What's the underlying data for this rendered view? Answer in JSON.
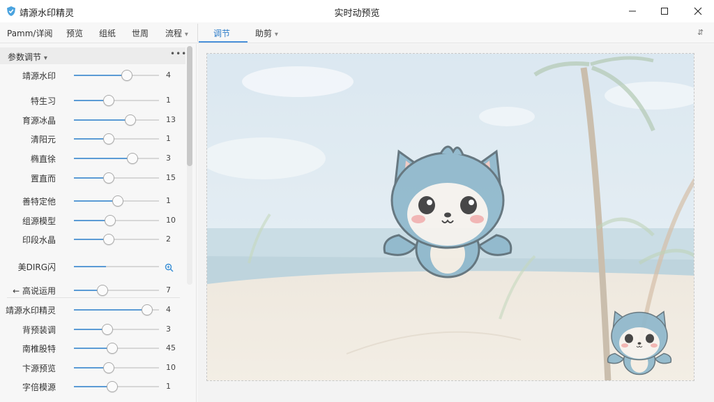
{
  "app": {
    "title": "靖源水印精灵",
    "window_title": "实时动预览",
    "icon": "shield-icon"
  },
  "window_controls": {
    "minimize_icon": "minimize-icon",
    "maximize_icon": "maximize-icon",
    "close_icon": "close-icon"
  },
  "menu": {
    "items": [
      "Pamm/详阅",
      "预览",
      "组纸",
      "世周",
      "流程"
    ],
    "dropdown_arrow": "▾",
    "tabs": [
      "调节",
      "助剪"
    ],
    "right_icon": "⇵"
  },
  "sidebar": {
    "panel_title": "参数调节",
    "panel_arrow": "▾",
    "more": "•••",
    "rows": [
      {
        "label": "靖源水印",
        "value": "4",
        "pos": 0.62
      },
      {
        "label": "特生习",
        "value": "1",
        "pos": 0.41
      },
      {
        "label": "育源冰晶",
        "value": "13",
        "pos": 0.66
      },
      {
        "label": "清阳元",
        "value": "1",
        "pos": 0.41
      },
      {
        "label": "椭直徐",
        "value": "3",
        "pos": 0.69
      },
      {
        "label": "置直而",
        "value": "15",
        "pos": 0.41
      },
      {
        "label": "善特定他",
        "value": "1",
        "pos": 0.52
      },
      {
        "label": "组源模型",
        "value": "10",
        "pos": 0.43
      },
      {
        "label": "印段水晶",
        "value": "2",
        "pos": 0.41
      },
      {
        "label": "美DIRG闪",
        "value": "",
        "pos": 0.38
      },
      {
        "label": "← 高说运用",
        "value": "7",
        "pos": 0.34
      },
      {
        "label": "靖源水印精灵",
        "value": "4",
        "pos": 0.86
      },
      {
        "label": "背预装调",
        "value": "3",
        "pos": 0.39
      },
      {
        "label": "南椎股特",
        "value": "45",
        "pos": 0.45
      },
      {
        "label": "卞源预览",
        "value": "10",
        "pos": 0.41
      },
      {
        "label": "字倍模源",
        "value": "1",
        "pos": 0.45
      }
    ],
    "zoom_icon": "zoom-in-icon"
  },
  "preview": {
    "colors": {
      "sky": "#d7e6f0",
      "sea": "#a9c9d6",
      "sand": "#ece3d6",
      "mascot": "#8fb8cc"
    }
  }
}
